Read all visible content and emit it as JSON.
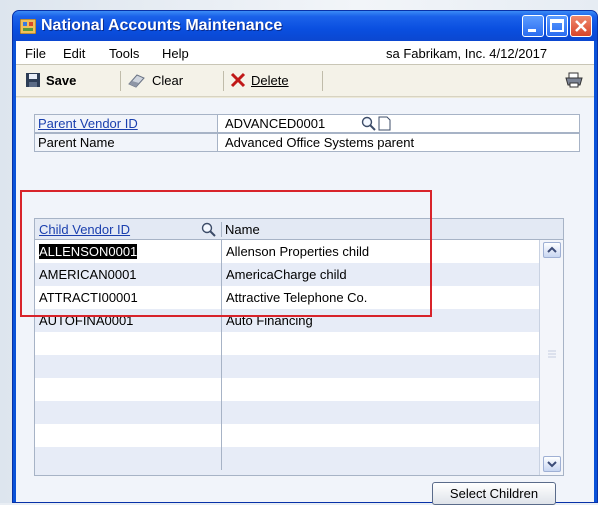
{
  "window": {
    "title": "National Accounts Maintenance"
  },
  "menu": {
    "items": [
      "File",
      "Edit",
      "Tools",
      "Help"
    ],
    "company_info": "sa  Fabrikam, Inc.  4/12/2017"
  },
  "toolbar": {
    "save_label": "Save",
    "clear_label": "Clear",
    "delete_label": "Delete"
  },
  "parent": {
    "vendor_id_label": "Parent Vendor ID",
    "vendor_id_value": "ADVANCED0001",
    "name_label": "Parent Name",
    "name_value": "Advanced Office Systems parent"
  },
  "grid": {
    "columns": [
      "Child Vendor ID",
      "Name"
    ],
    "rows": [
      {
        "vendor_id": "ALLENSON0001",
        "name": "Allenson Properties child"
      },
      {
        "vendor_id": "AMERICAN0001",
        "name": "AmericaCharge child"
      },
      {
        "vendor_id": "ATTRACTI00001",
        "name": "Attractive Telephone Co."
      },
      {
        "vendor_id": "AUTOFINA0001",
        "name": "Auto Financing"
      }
    ]
  },
  "buttons": {
    "select_children": "Select Children"
  },
  "colors": {
    "title_bar": "#0a4fe0",
    "highlight_box": "#d8232a",
    "link": "#1a3fae"
  }
}
